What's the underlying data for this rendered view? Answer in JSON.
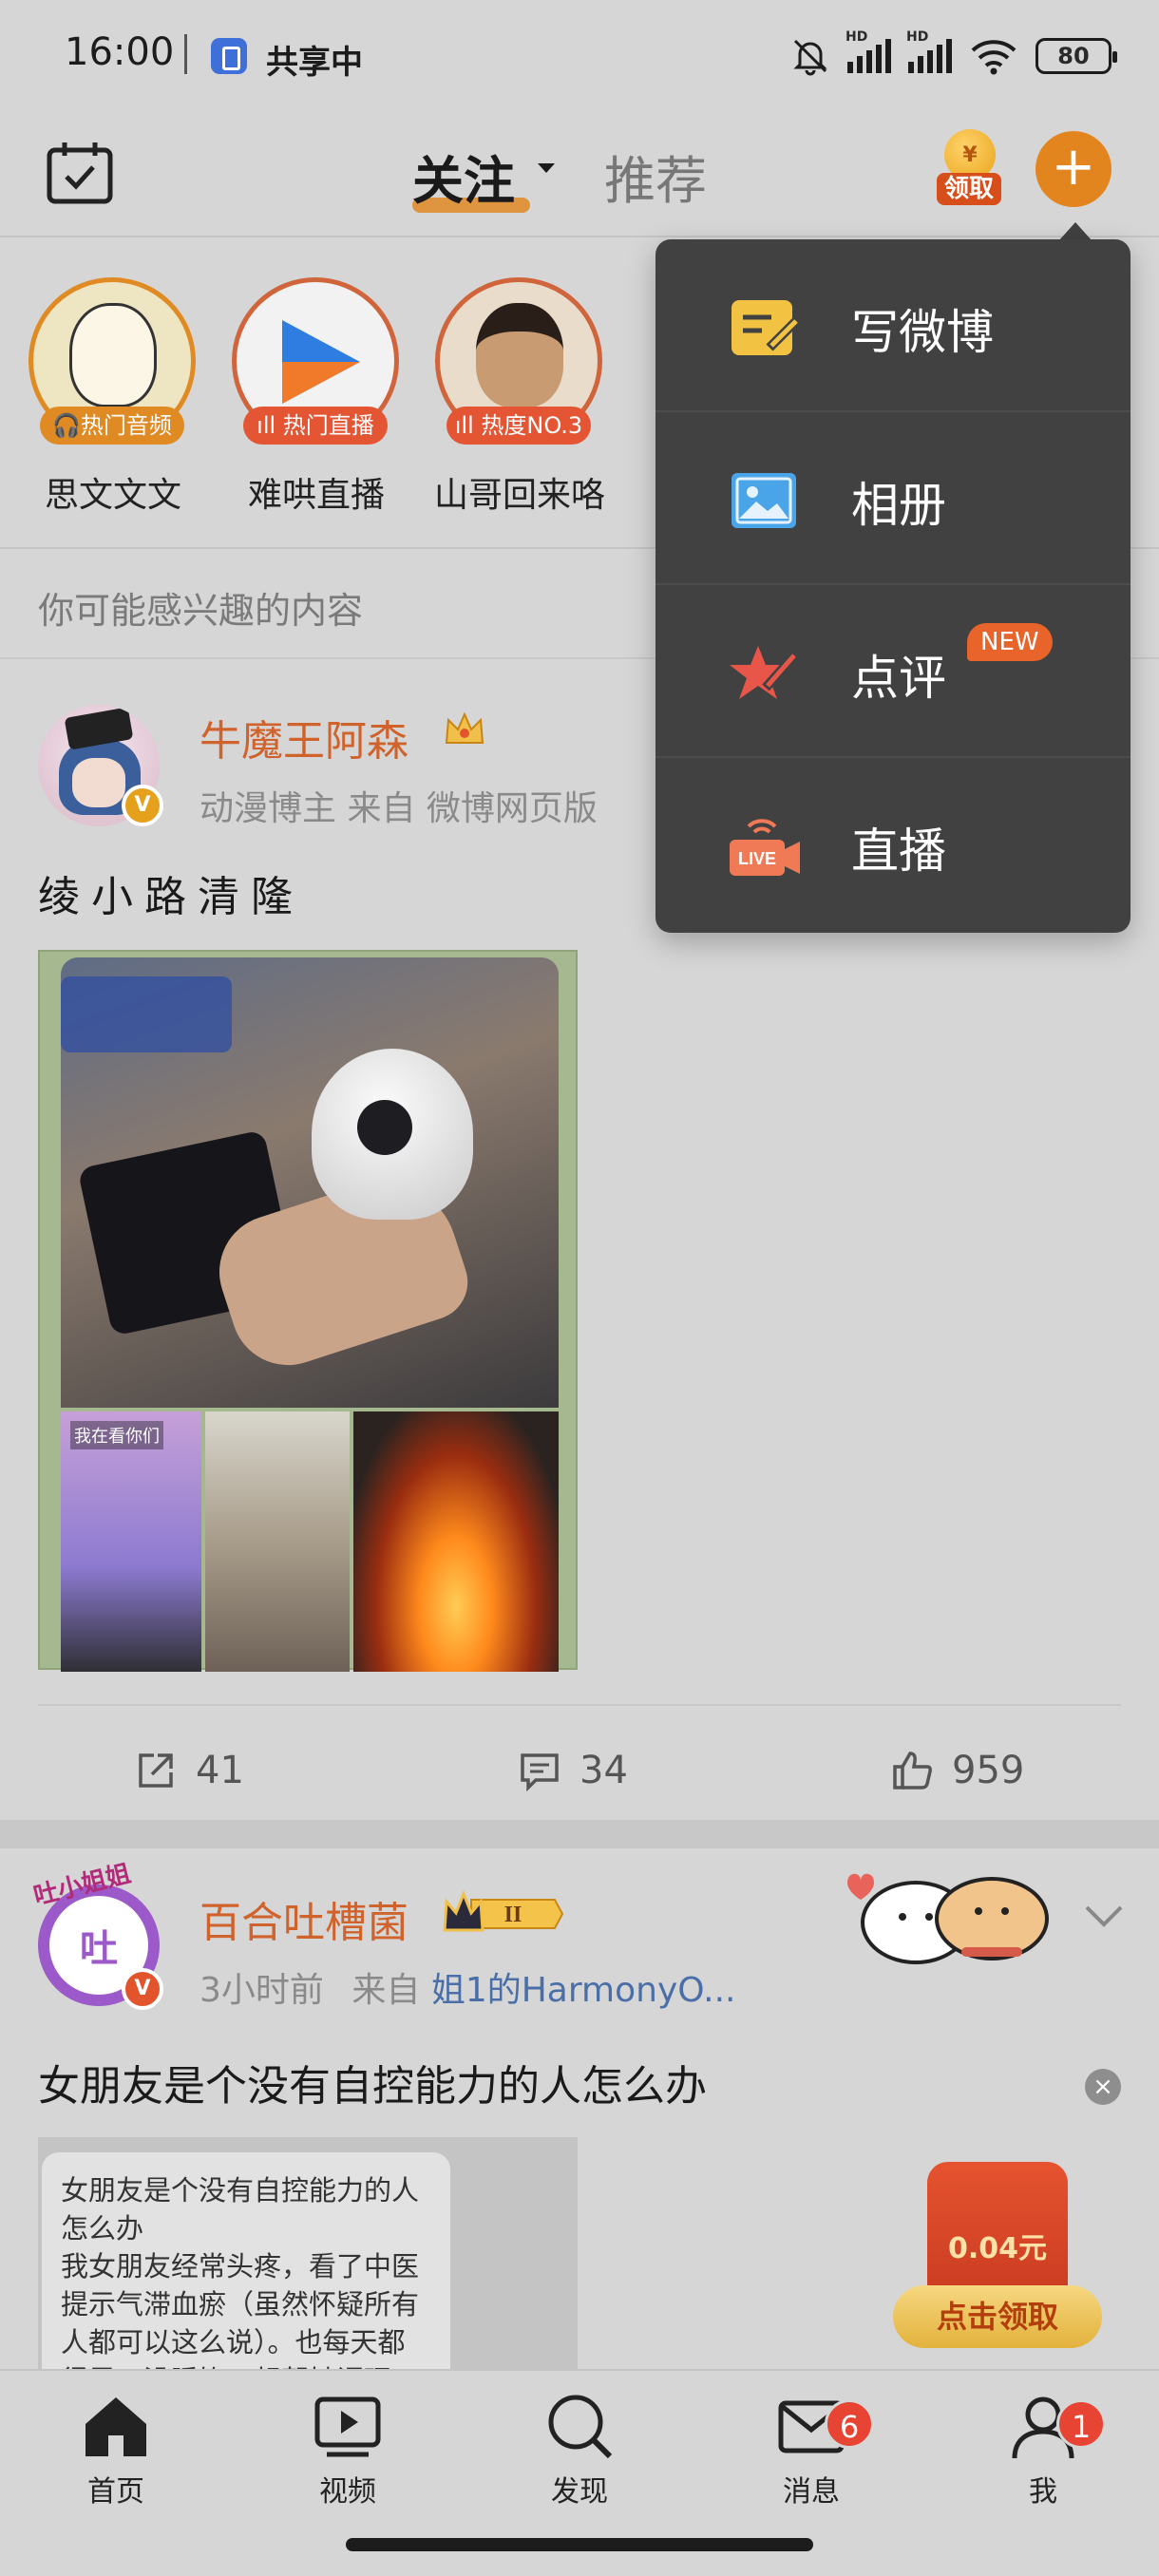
{
  "status_bar": {
    "time": "16:00",
    "share_label": "共享中",
    "signal1_label": "HD",
    "signal2_label": "HD",
    "battery": "80"
  },
  "top_nav": {
    "tabs": [
      {
        "label": "关注",
        "active": true
      },
      {
        "label": "推荐",
        "active": false
      }
    ],
    "claim_label": "领取",
    "claim_coin": "¥",
    "compose_symbol": "+"
  },
  "stories": [
    {
      "name": "思文文文",
      "tag": "🎧热门音频",
      "tag_color": "#e08a24"
    },
    {
      "name": "难哄直播",
      "tag": "ıll 热门直播",
      "tag_color": "#e45534"
    },
    {
      "name": "山哥回来咯",
      "tag": "ıll 热度NO.3",
      "tag_color": "#e45534"
    }
  ],
  "suggest_text": "你可能感兴趣的内容",
  "post1": {
    "author": "牛魔王阿森",
    "meta": "动漫博主   来自 微博网页版",
    "text": "绫小路清隆",
    "image_caption": "我在看你们",
    "verified_mark": "V",
    "actions": {
      "reposts": "41",
      "comments": "34",
      "likes": "959"
    }
  },
  "post2": {
    "author": "百合吐槽菌",
    "avatar_char": "吐",
    "avatar_tag": "吐小姐姐",
    "level_badge": "II",
    "verified_mark": "V",
    "meta_time": "3小时前",
    "meta_from": "来自",
    "meta_source": "姐1的HarmonyO...",
    "text": "女朋友是个没有自控能力的人怎么办",
    "card_text": "女朋友是个没有自控能力的人怎么办\n我女朋友经常头疼，看了中医提示气滞血瘀（虽然怀疑所有人都可以这么说）。也每天都得思，没睡饱，想帮她调理",
    "close_symbol": "×"
  },
  "red_packet": {
    "amount": "0.04元",
    "button": "点击领取"
  },
  "bottom_nav": [
    {
      "label": "首页",
      "icon": "home-icon"
    },
    {
      "label": "视频",
      "icon": "video-icon"
    },
    {
      "label": "发现",
      "icon": "search-icon"
    },
    {
      "label": "消息",
      "icon": "mail-icon",
      "badge": "6"
    },
    {
      "label": "我",
      "icon": "profile-icon",
      "badge": "1"
    }
  ],
  "menu": {
    "items": [
      {
        "label": "写微博",
        "icon": "write-post-icon"
      },
      {
        "label": "相册",
        "icon": "album-icon"
      },
      {
        "label": "点评",
        "icon": "review-icon",
        "badge": "NEW"
      },
      {
        "label": "直播",
        "icon": "live-icon",
        "icon_text": "LIVE"
      }
    ]
  },
  "colors": {
    "accent": "#e3851e",
    "name": "#d0622b",
    "menu_bg": "#414141",
    "badge_red": "#e74433"
  }
}
